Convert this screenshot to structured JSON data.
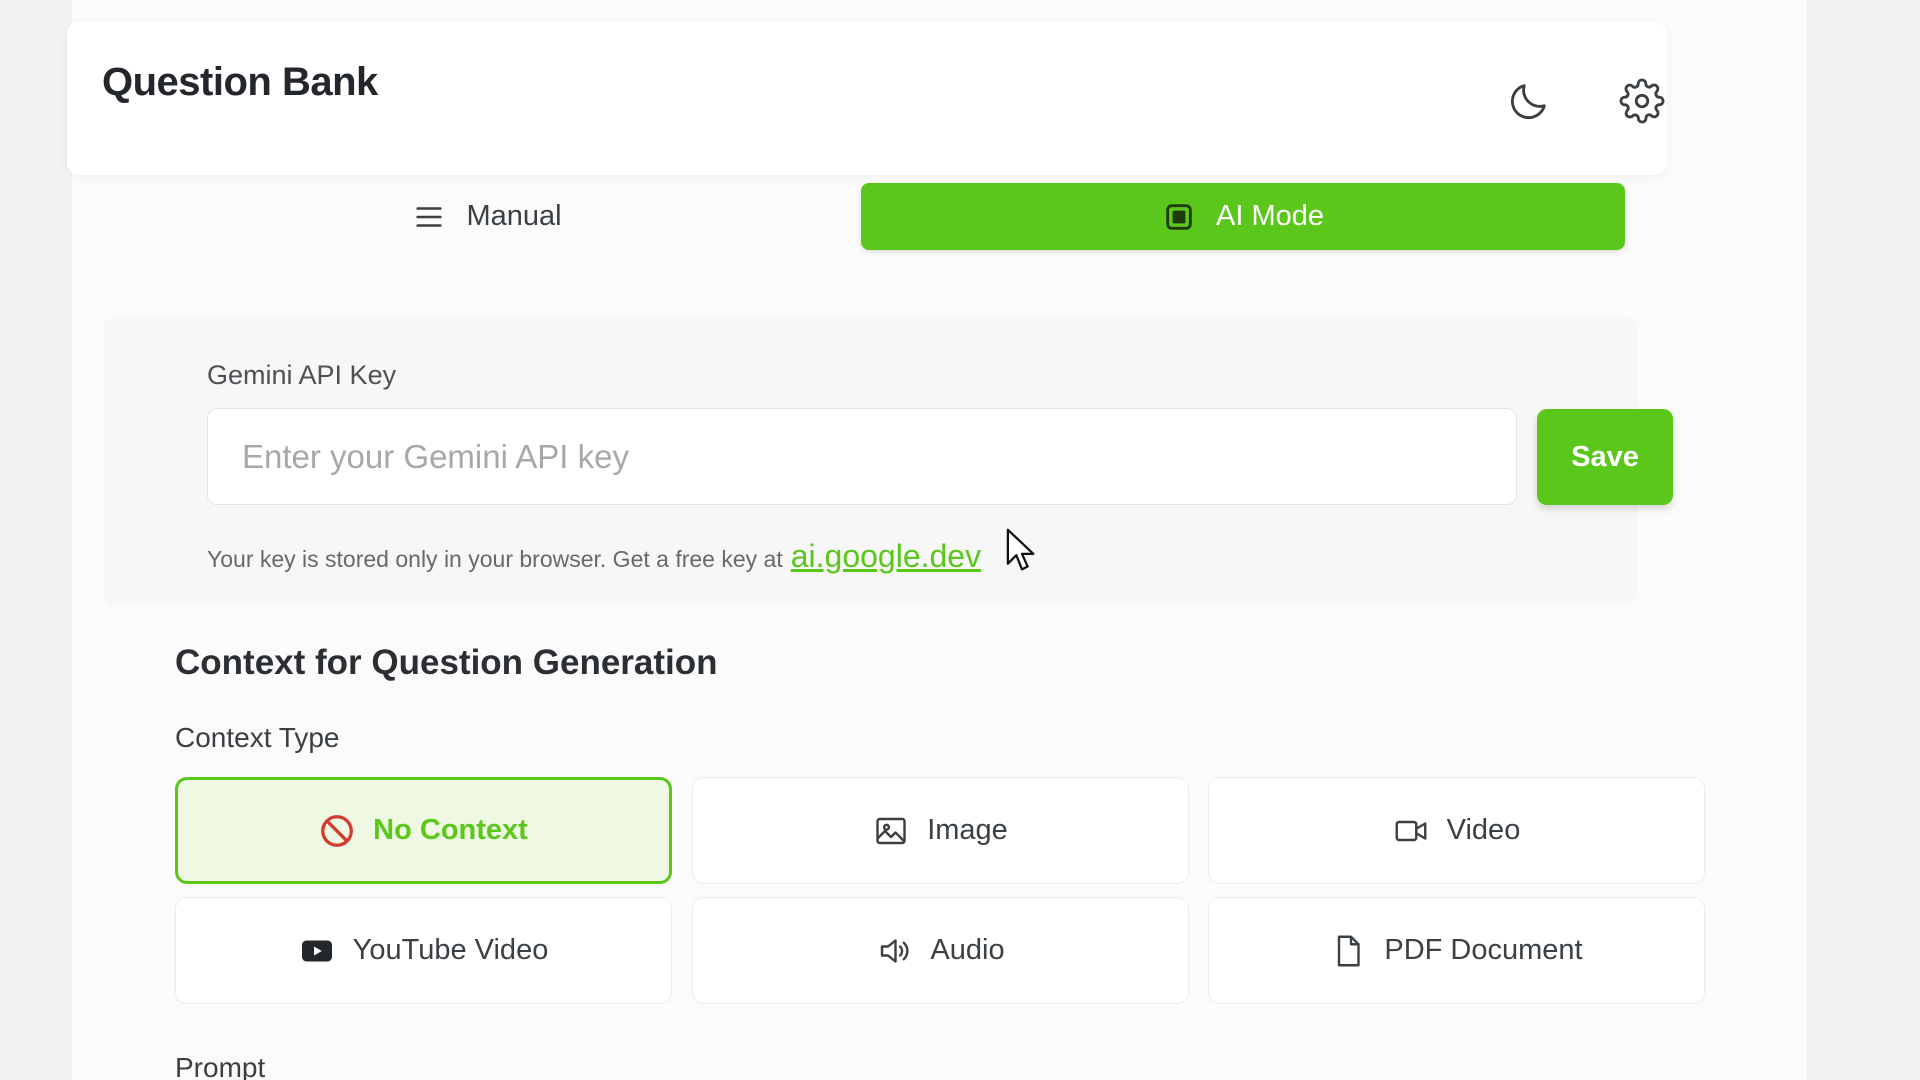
{
  "app": {
    "title": "Question Bank"
  },
  "header": {
    "icons": [
      "moon-icon",
      "gear-icon"
    ]
  },
  "mode_tabs": [
    {
      "label": "Manual",
      "icon": "menu-icon",
      "active": false
    },
    {
      "label": "AI Mode",
      "icon": "chip-icon",
      "active": true
    }
  ],
  "api_key": {
    "label": "Gemini API Key",
    "placeholder": "Enter your Gemini API key",
    "value": "",
    "save_label": "Save",
    "help_text": "Your key is stored only in your browser. Get a free key at",
    "link_text": "ai.google.dev"
  },
  "context": {
    "section_title": "Context for Question Generation",
    "type_label": "Context Type",
    "options": [
      {
        "label": "No Context",
        "icon": "no-entry-icon",
        "selected": true
      },
      {
        "label": "Image",
        "icon": "image-icon",
        "selected": false
      },
      {
        "label": "Video",
        "icon": "video-icon",
        "selected": false
      },
      {
        "label": "YouTube Video",
        "icon": "youtube-icon",
        "selected": false
      },
      {
        "label": "Audio",
        "icon": "speaker-icon",
        "selected": false
      },
      {
        "label": "PDF Document",
        "icon": "document-icon",
        "selected": false
      }
    ]
  },
  "prompt": {
    "label": "Prompt"
  },
  "colors": {
    "accent": "#5bc71a",
    "accent_light": "#eef8e2",
    "background": "#f1f2f3",
    "panel": "#fbfbfb"
  }
}
